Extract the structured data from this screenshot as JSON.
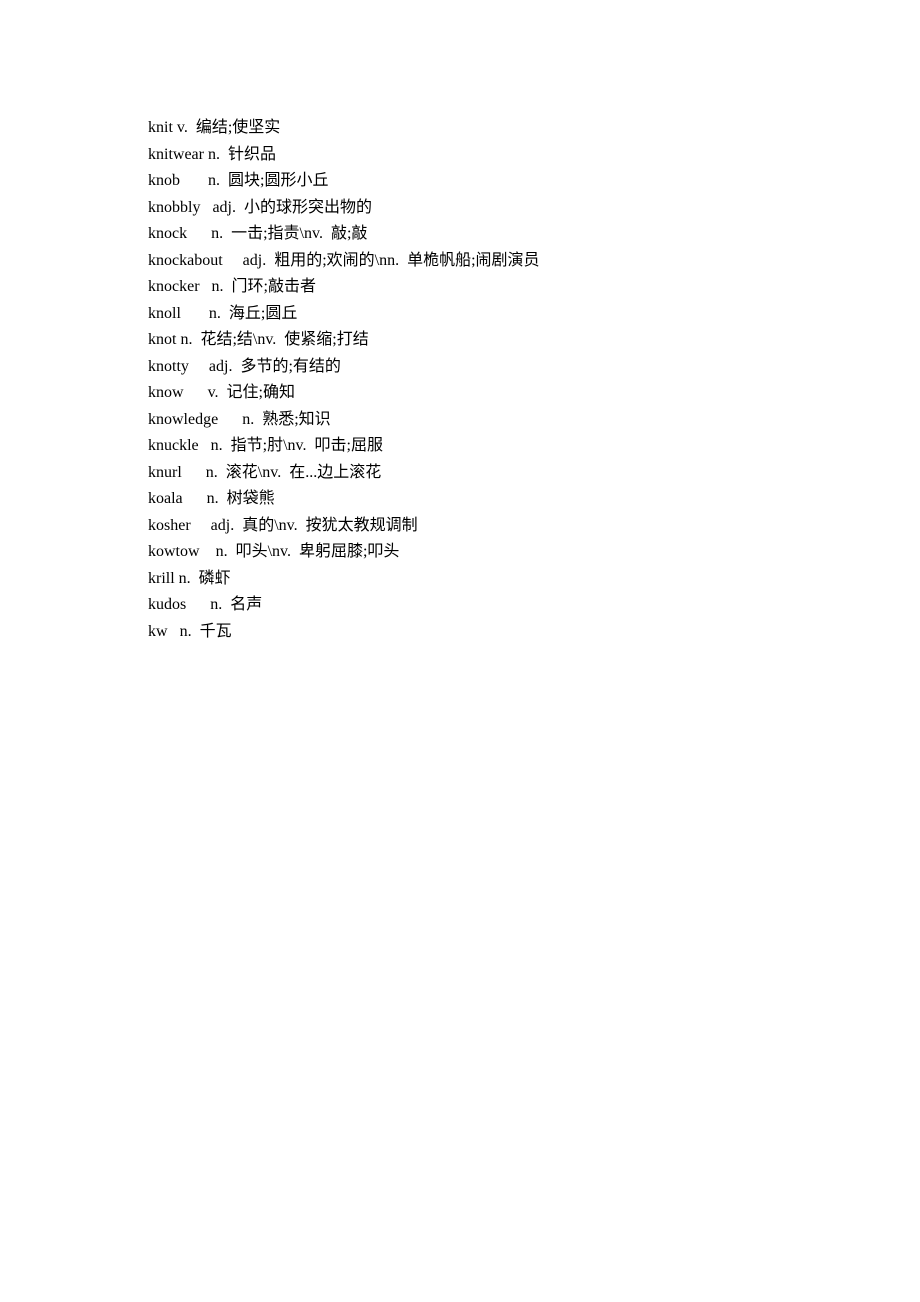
{
  "entries": [
    {
      "word": "knit",
      "definition": "v.  编结;使坚实"
    },
    {
      "word": "knitwear",
      "definition": "n.  针织品"
    },
    {
      "word": "knob",
      "definition": "      n.  圆块;圆形小丘"
    },
    {
      "word": "knobbly",
      "definition": "  adj.  小的球形突出物的"
    },
    {
      "word": "knock",
      "definition": "     n.  一击;指责\\nv.  敲;敲"
    },
    {
      "word": "knockabout",
      "definition": "    adj.  粗用的;欢闹的\\nn.  单桅帆船;闹剧演员"
    },
    {
      "word": "knocker",
      "definition": "  n.  门环;敲击者"
    },
    {
      "word": "knoll",
      "definition": "      n.  海丘;圆丘"
    },
    {
      "word": "knot",
      "definition": "n.  花结;结\\nv.  使紧缩;打结"
    },
    {
      "word": "knotty",
      "definition": "    adj.  多节的;有结的"
    },
    {
      "word": "know",
      "definition": "     v.  记住;确知"
    },
    {
      "word": "knowledge",
      "definition": "     n.  熟悉;知识"
    },
    {
      "word": "knuckle",
      "definition": "  n.  指节;肘\\nv.  叩击;屈服"
    },
    {
      "word": "knurl",
      "definition": "     n.  滚花\\nv.  在...边上滚花"
    },
    {
      "word": "koala",
      "definition": "     n.  树袋熊"
    },
    {
      "word": "kosher",
      "definition": "    adj.  真的\\nv.  按犹太教规调制"
    },
    {
      "word": "kowtow",
      "definition": "   n.  叩头\\nv.  卑躬屈膝;叩头"
    },
    {
      "word": "krill",
      "definition": "n.  磷虾"
    },
    {
      "word": "kudos",
      "definition": "     n.  名声"
    },
    {
      "word": "kw",
      "definition": "  n.  千瓦"
    }
  ]
}
